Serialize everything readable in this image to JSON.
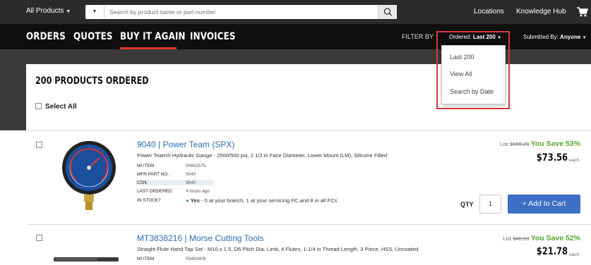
{
  "topbar": {
    "category_label": "All Products",
    "search_placeholder": "Search by product name or part number",
    "links": [
      "Locations",
      "Knowledge Hub"
    ]
  },
  "nav": {
    "tabs": [
      "ORDERS",
      "QUOTES",
      "BUY IT AGAIN",
      "INVOICES"
    ],
    "active_tab": "BUY IT AGAIN",
    "filter_by": "FILTER BY",
    "ordered_prefix": "Ordered:",
    "ordered_value": "Last 200",
    "submitted_prefix": "Submitted By:",
    "submitted_value": "Anyone"
  },
  "dropdown": {
    "options": [
      "Last 200",
      "View All",
      "Search by Date"
    ]
  },
  "header": {
    "title": "200 PRODUCTS ORDERED",
    "select_all": "Select All"
  },
  "products": [
    {
      "part": "9040",
      "brand": "Power Team (SPX)",
      "description": "Power Team® Hydraulic Gauge - 2500/500 psi, 2 1/2 in Face Diameter, Lower Mount (LM), Silicone Filled",
      "meta_labels": [
        "MI ITEM",
        "MFR PART NO.",
        "CSN:",
        "LAST ORDERED",
        "IN STOCK?"
      ],
      "meta_values": [
        "00842575",
        "9040",
        "9040",
        "4 hours ago"
      ],
      "stock_yes": "Yes",
      "stock_text": " - 0 at your branch, 1 at your servicing FC and 8 in all FCs",
      "list_label": "List",
      "list_price": "$155.29",
      "save_text": "You Save 53%",
      "price": "$73.56",
      "each": "each",
      "qty_label": "QTY",
      "qty_value": "1",
      "add_to_cart": "+ Add to Cart"
    },
    {
      "part": "MT3838216",
      "brand": "Morse Cutting Tools",
      "description": "Straight Flute Hand Tap Set - M10 x 1.5, D6 Pitch Dia. Limit, 4 Flutes, 1-1/4 in Thread Length, 3 Piece, HSS, Uncoated",
      "meta_labels": [
        "MI ITEM"
      ],
      "meta_values": [
        "03483409"
      ],
      "list_label": "List",
      "list_price": "$45.53",
      "save_text": "You Save 52%",
      "price": "$21.78",
      "each": "each"
    }
  ],
  "colors": {
    "accent_red": "#e0352b",
    "link_blue": "#2f6db5",
    "save_green": "#55a630",
    "button_blue": "#3d6fc4"
  }
}
